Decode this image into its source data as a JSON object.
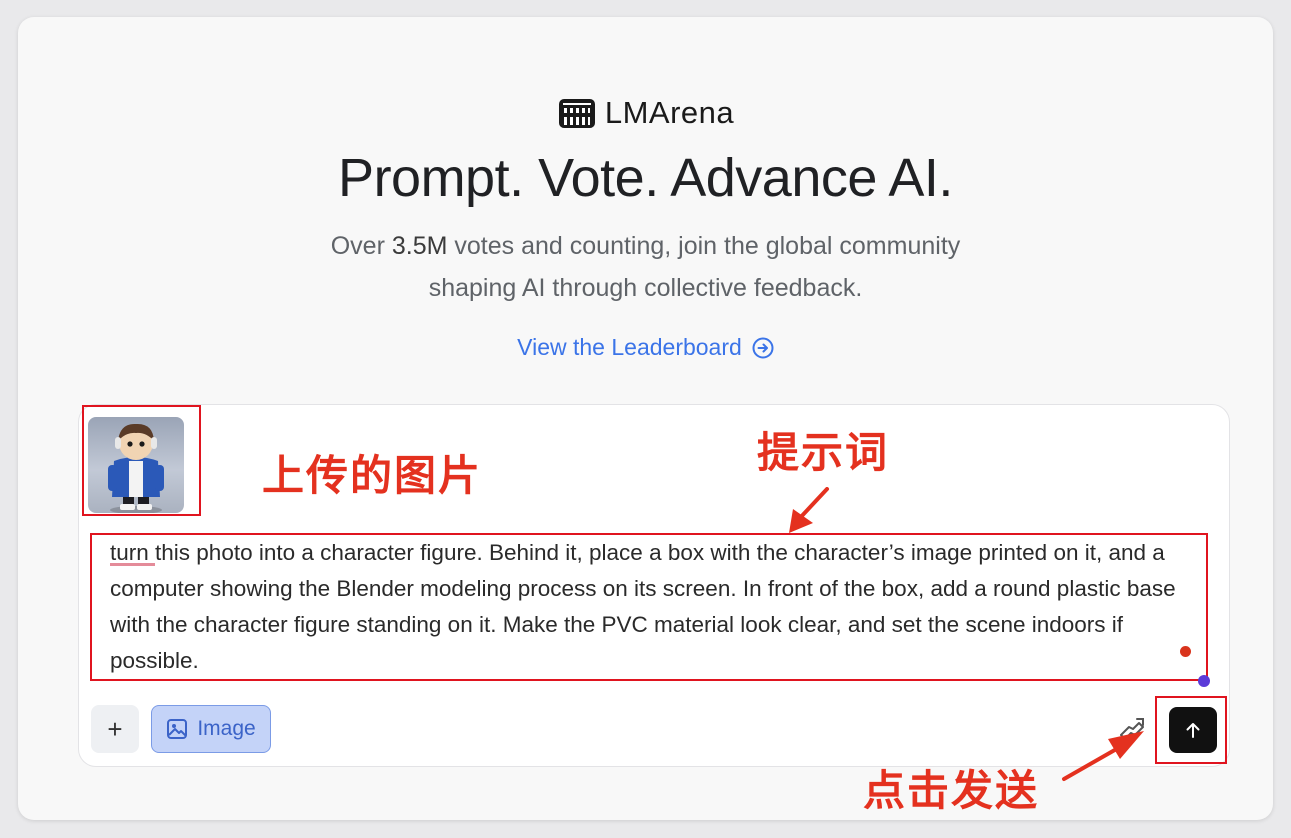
{
  "brand": {
    "name": "LMArena",
    "logo_icon": "colosseum-icon"
  },
  "hero": {
    "headline": "Prompt. Vote. Advance AI.",
    "sub_line1_prefix": "Over ",
    "sub_line1_count": "3.5M",
    "sub_line1_suffix": " votes and counting, join the global community",
    "sub_line2": "shaping AI through collective feedback."
  },
  "leaderboard_link": {
    "label": "View the Leaderboard",
    "icon": "arrow-right-circle-icon"
  },
  "composer": {
    "uploaded_image_alt": "character figure photo",
    "prompt_value": "turn this photo into a character figure. Behind it, place a box with the character’s image printed on it, and a computer showing the Blender modeling process on its screen. In front of the box, add a round plastic base with the character figure standing on it. Make the PVC material look clear, and set the scene indoors if possible.",
    "plus_label": "+",
    "image_mode_label": "Image",
    "image_mode_icon": "image-icon",
    "tool_icon": "robot-hand-icon",
    "send_icon": "arrow-up-icon"
  },
  "annotations": {
    "uploaded_image": "上传的图片",
    "prompt": "提示词",
    "send": "点击发送"
  },
  "colors": {
    "accent_link": "#3b74e8",
    "annotation_red": "#e4311f",
    "image_button_bg": "#c4d3f8",
    "send_button_bg": "#111111"
  }
}
